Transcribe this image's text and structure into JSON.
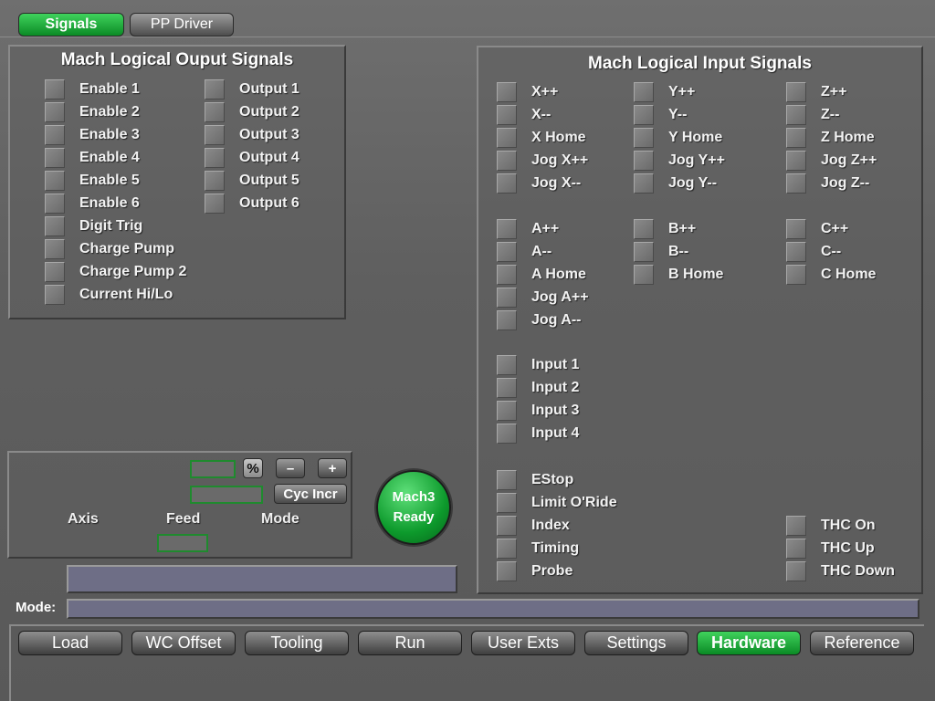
{
  "top_tabs": {
    "signals": "Signals",
    "pp_driver": "PP Driver"
  },
  "output_panel": {
    "title": "Mach Logical Ouput Signals",
    "col1": [
      "Enable 1",
      "Enable 2",
      "Enable 3",
      "Enable 4",
      "Enable 5",
      "Enable 6",
      "Digit Trig",
      "Charge Pump",
      "Charge Pump 2",
      "Current Hi/Lo"
    ],
    "col2": [
      "Output 1",
      "Output 2",
      "Output 3",
      "Output 4",
      "Output 5",
      "Output 6"
    ]
  },
  "input_panel": {
    "title": "Mach Logical Input Signals",
    "x_axis": [
      "X++",
      "X--",
      "X Home",
      "Jog X++",
      "Jog X--"
    ],
    "y_axis": [
      "Y++",
      "Y--",
      "Y Home",
      "Jog Y++",
      "Jog Y--"
    ],
    "z_axis": [
      "Z++",
      "Z--",
      "Z Home",
      "Jog Z++",
      "Jog Z--"
    ],
    "a_axis": [
      "A++",
      "A--",
      "A Home",
      "Jog A++",
      "Jog A--"
    ],
    "b_axis": [
      "B++",
      "B--",
      "B Home"
    ],
    "c_axis": [
      "C++",
      "C--",
      "C Home"
    ],
    "inputs": [
      "Input 1",
      "Input 2",
      "Input 3",
      "Input 4"
    ],
    "misc": [
      "EStop",
      "Limit O'Ride",
      "Index",
      "Timing",
      "Probe"
    ],
    "thc": [
      "THC On",
      "THC Up",
      "THC Down"
    ]
  },
  "control": {
    "percent_label": "%",
    "minus_label": "–",
    "plus_label": "+",
    "cyc_incr_label": "Cyc Incr",
    "axis_label": "Axis",
    "feed_label": "Feed",
    "mode_label": "Mode"
  },
  "ready_button": {
    "line1": "Mach3",
    "line2": "Ready"
  },
  "mode_label": "Mode:",
  "nav": [
    "Load",
    "WC Offset",
    "Tooling",
    "Run",
    "User Exts",
    "Settings",
    "Hardware",
    "Reference"
  ],
  "active_nav": "Hardware"
}
